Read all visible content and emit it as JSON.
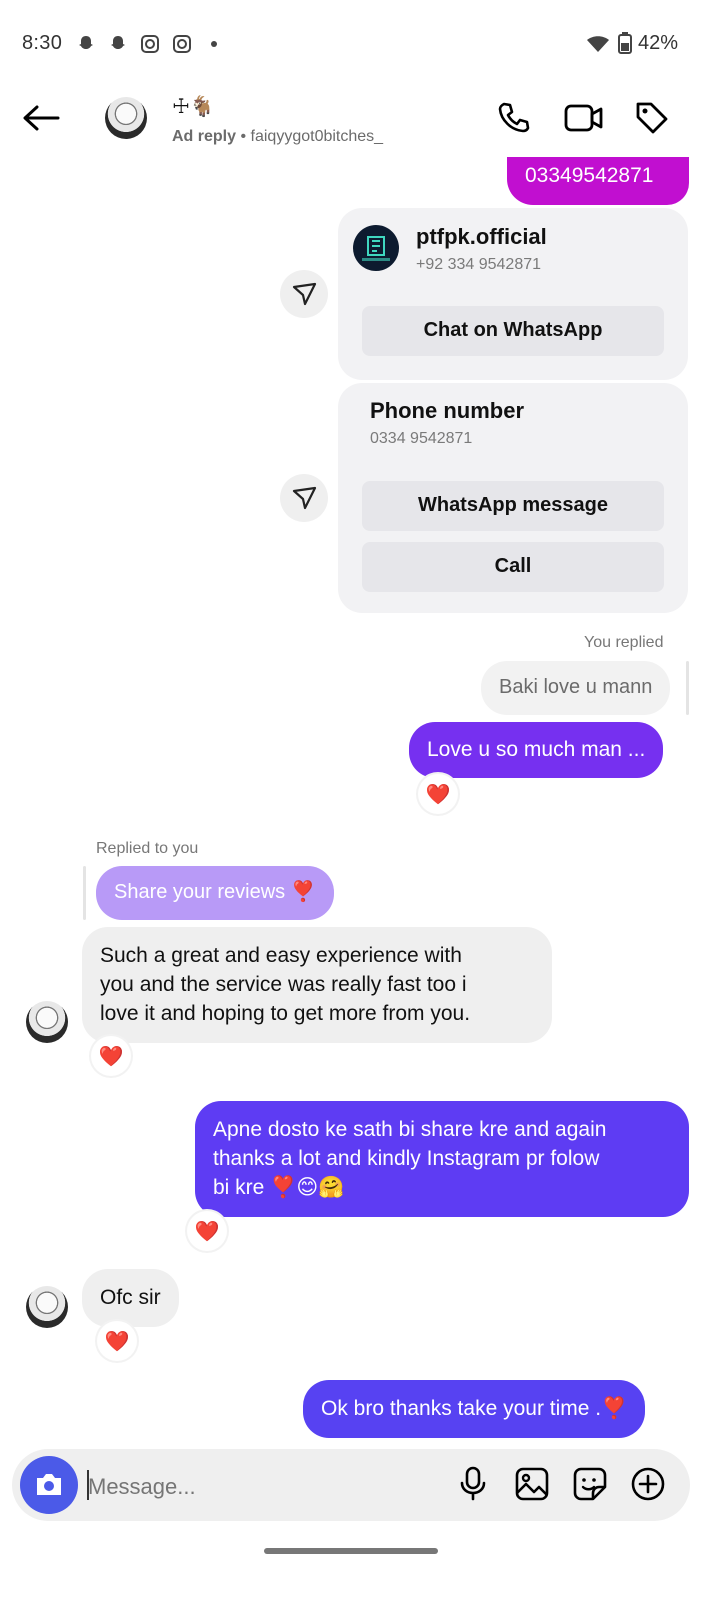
{
  "status_bar": {
    "time": "8:30",
    "battery": "42%"
  },
  "header": {
    "title": "☩🐐",
    "ad_reply": "Ad reply",
    "separator": "•",
    "username": "faiqyygot0bitches_"
  },
  "messages": {
    "number_msg": "03349542871",
    "contact_card": {
      "name": "ptfpk.official",
      "number": "+92 334 9542871",
      "button": "Chat on WhatsApp"
    },
    "phone_card": {
      "heading": "Phone number",
      "number": "0334 9542871",
      "whatsapp_button": "WhatsApp message",
      "call_button": "Call"
    },
    "you_replied_label": "You replied",
    "quoted_reply": "Baki love u mann",
    "love_msg": "Love u so much man ...",
    "replied_to_you_label": "Replied to you",
    "quoted_share": "Share your reviews ❣️",
    "review_msg": "Such a great and easy experience with\nyou and the service was really fast too i\nlove it and hoping to get more from you.",
    "apne_msg": "Apne dosto ke sath bi share kre and again\nthanks a lot and kindly Instagram pr folow\nbi kre ❣️😊🤗",
    "ofc_msg": "Ofc sir",
    "ok_msg": "Ok bro thanks take your time .❣️",
    "reaction": "❤️"
  },
  "composer": {
    "placeholder": "Message..."
  },
  "colors": {
    "pink_bubble": "#c10fd0",
    "purple_bubble": "#7630f0",
    "indigo_bubble": "#5e3cf3",
    "blue_bubble": "#5742f2",
    "quoted_bubble": "#b89af7",
    "camera_button": "#4b5ae8"
  }
}
